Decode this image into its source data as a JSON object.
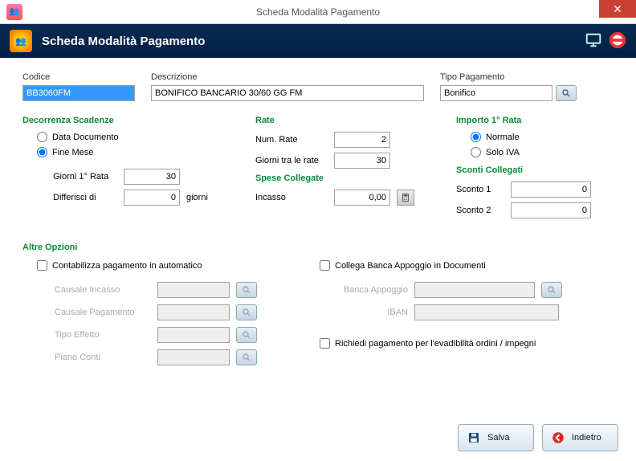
{
  "window": {
    "title": "Scheda Modalità Pagamento"
  },
  "header": {
    "title": "Scheda Modalità Pagamento"
  },
  "top": {
    "codice_label": "Codice",
    "codice_value": "BB3060FM",
    "descrizione_label": "Descrizione",
    "descrizione_value": "BONIFICO BANCARIO 30/60 GG FM",
    "tipo_label": "Tipo Pagamento",
    "tipo_value": "Bonifico"
  },
  "decorrenza": {
    "title": "Decorrenza Scadenze",
    "opt_data_documento": "Data Documento",
    "opt_fine_mese": "Fine Mese",
    "giorni_prima_rata_label": "Giorni 1° Rata",
    "giorni_prima_rata_value": "30",
    "differisci_label": "Differisci di",
    "differisci_value": "0",
    "giorni_suffix": "giorni"
  },
  "rate": {
    "title": "Rate",
    "num_rate_label": "Num. Rate",
    "num_rate_value": "2",
    "giorni_tra_rate_label": "Giorni tra le rate",
    "giorni_tra_rate_value": "30"
  },
  "spese": {
    "title": "Spese Collegate",
    "incasso_label": "Incasso",
    "incasso_value": "0,00"
  },
  "importo": {
    "title": "Importo 1° Rata",
    "opt_normale": "Normale",
    "opt_solo_iva": "Solo IVA"
  },
  "sconti": {
    "title": "Sconti Collegati",
    "sconto1_label": "Sconto 1",
    "sconto1_value": "0",
    "sconto2_label": "Sconto 2",
    "sconto2_value": "0"
  },
  "altre": {
    "title": "Altre Opzioni",
    "contabilizza_label": "Contabilizza pagamento in automatico",
    "causale_incasso_label": "Causale Incasso",
    "causale_pagamento_label": "Causale Pagamento",
    "tipo_effetto_label": "Tipo Effetto",
    "piano_conti_label": "Piano Conti",
    "collega_banca_label": "Collega Banca Appoggio in Documenti",
    "banca_appoggio_label": "Banca Appoggio",
    "iban_label": "IBAN",
    "richiedi_label": "Richiedi pagamento per l'evadibilità ordini / impegni"
  },
  "footer": {
    "salva": "Salva",
    "indietro": "Indietro"
  }
}
